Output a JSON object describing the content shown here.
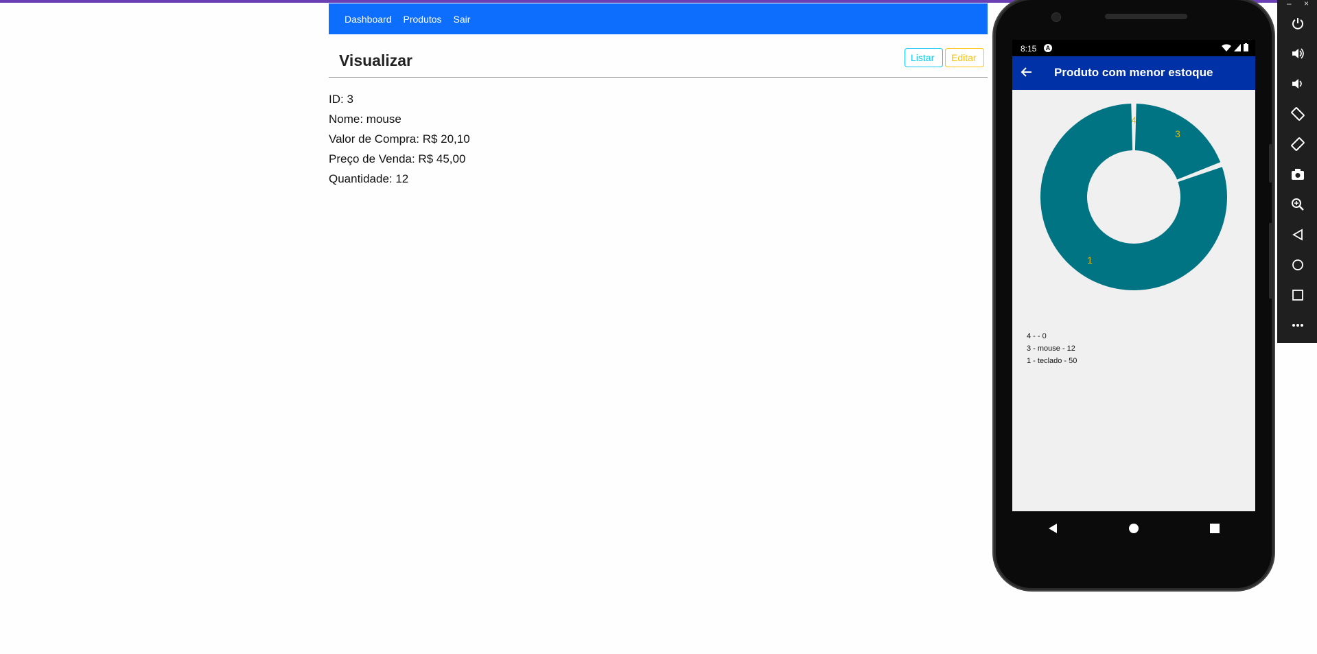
{
  "navbar": {
    "links": [
      "Dashboard",
      "Produtos",
      "Sair"
    ]
  },
  "page": {
    "title": "Visualizar",
    "buttons": {
      "listar": "Listar",
      "editar": "Editar"
    },
    "details": [
      "ID: 3",
      "Nome: mouse",
      "Valor de Compra: R$ 20,10",
      "Preço de Venda: R$ 45,00",
      "Quantidade: 12"
    ]
  },
  "phone": {
    "status_time": "8:15",
    "status_badge": "A",
    "app_title": "Produto com menor estoque",
    "legend": [
      "4 -  - 0",
      "3 - mouse - 12",
      "1 - teclado - 50"
    ]
  },
  "chart_data": {
    "type": "pie",
    "categories": [
      "4",
      "3",
      "1"
    ],
    "values": [
      0,
      12,
      50
    ],
    "slice_labels": [
      "4",
      "3",
      "1"
    ],
    "donut": true,
    "slice_color": "#007483",
    "label_color": "#e6b800"
  },
  "colors": {
    "navbar": "#0d6efd",
    "app_bar": "#0031a6",
    "listar": "#0dcaf0",
    "editar": "#ffc107"
  },
  "emulator": {
    "window_controls": [
      "–",
      "×"
    ],
    "icons": [
      "power-icon",
      "volume-up-icon",
      "volume-down-icon",
      "rotate-left-icon",
      "rotate-right-icon",
      "camera-icon",
      "zoom-icon",
      "back-icon",
      "home-icon",
      "overview-icon",
      "more-icon"
    ]
  }
}
